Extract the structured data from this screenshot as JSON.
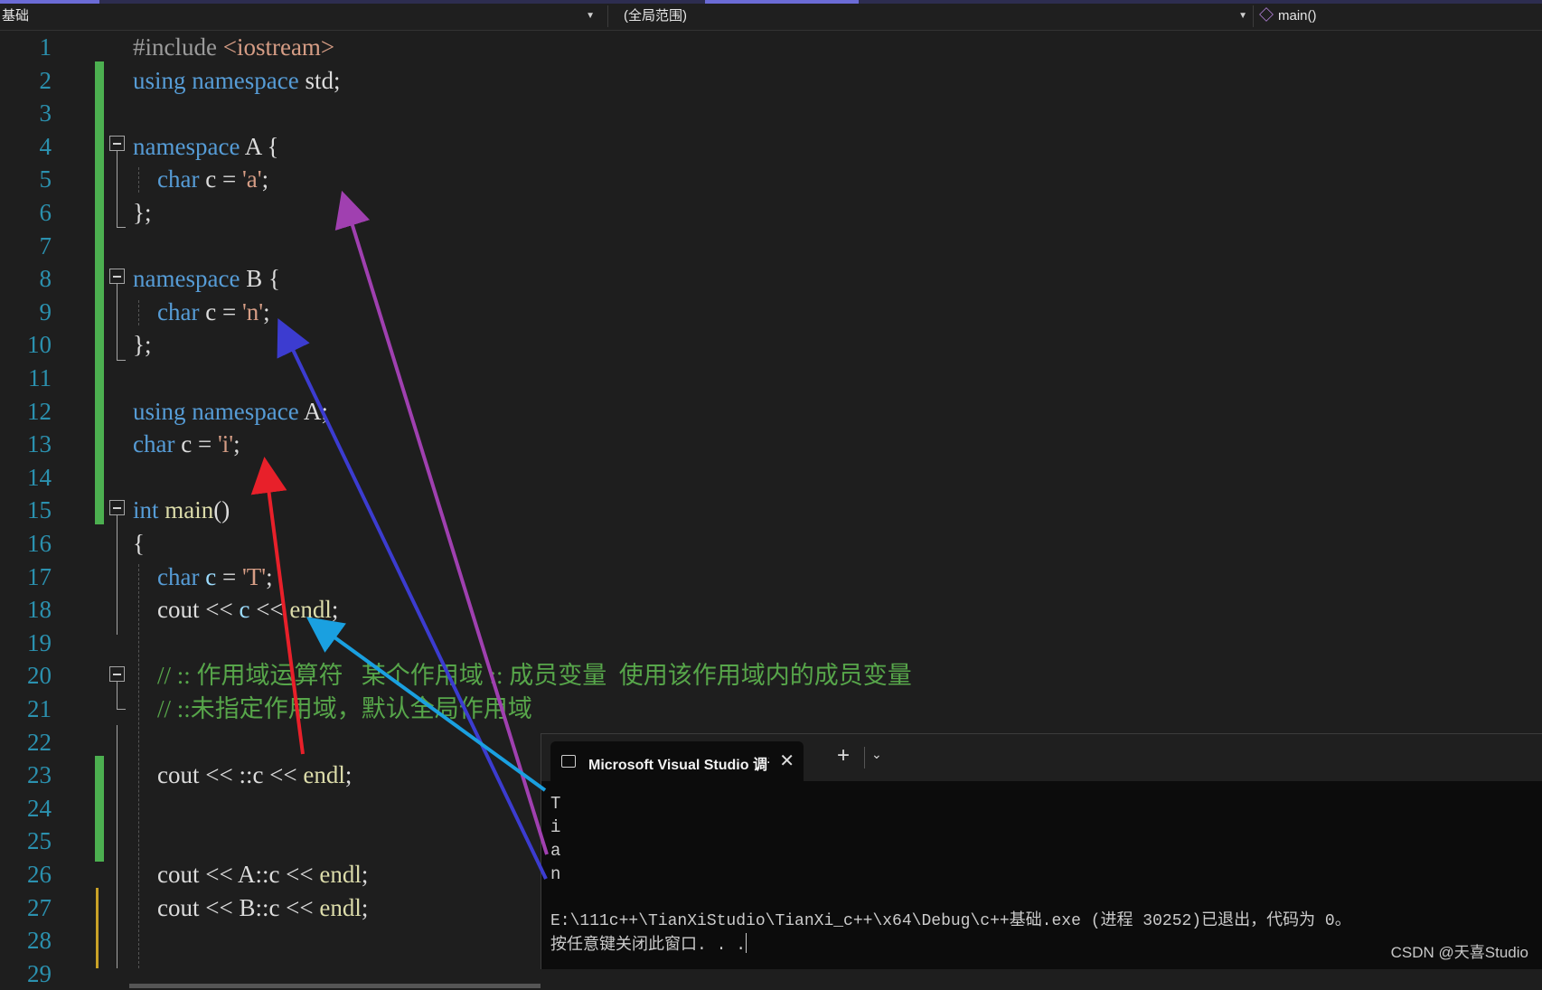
{
  "navbar": {
    "project": "基础",
    "scope": "(全局范围)",
    "member": "main()"
  },
  "editor": {
    "lines": [
      {
        "n": "1",
        "tokens": [
          {
            "t": "#include ",
            "c": "inc"
          },
          {
            "t": "<iostream>",
            "c": "str"
          }
        ]
      },
      {
        "n": "2",
        "tokens": [
          {
            "t": "using",
            "c": "kw"
          },
          {
            "t": " "
          },
          {
            "t": "namespace",
            "c": "kw"
          },
          {
            "t": " std;"
          }
        ]
      },
      {
        "n": "3",
        "tokens": []
      },
      {
        "n": "4",
        "tokens": [
          {
            "t": "namespace",
            "c": "kw"
          },
          {
            "t": " A {"
          }
        ]
      },
      {
        "n": "5",
        "tokens": [
          {
            "t": "    "
          },
          {
            "t": "char",
            "c": "kw"
          },
          {
            "t": " c = "
          },
          {
            "t": "'a'",
            "c": "str"
          },
          {
            "t": ";"
          }
        ]
      },
      {
        "n": "6",
        "tokens": [
          {
            "t": "};"
          }
        ]
      },
      {
        "n": "7",
        "tokens": []
      },
      {
        "n": "8",
        "tokens": [
          {
            "t": "namespace",
            "c": "kw"
          },
          {
            "t": " B {"
          }
        ]
      },
      {
        "n": "9",
        "tokens": [
          {
            "t": "    "
          },
          {
            "t": "char",
            "c": "kw"
          },
          {
            "t": " c = "
          },
          {
            "t": "'n'",
            "c": "str"
          },
          {
            "t": ";"
          }
        ]
      },
      {
        "n": "10",
        "tokens": [
          {
            "t": "};"
          }
        ]
      },
      {
        "n": "11",
        "tokens": []
      },
      {
        "n": "12",
        "tokens": [
          {
            "t": "using",
            "c": "kw"
          },
          {
            "t": " "
          },
          {
            "t": "namespace",
            "c": "kw"
          },
          {
            "t": " A;"
          }
        ]
      },
      {
        "n": "13",
        "tokens": [
          {
            "t": "char",
            "c": "kw"
          },
          {
            "t": " c = "
          },
          {
            "t": "'i'",
            "c": "str"
          },
          {
            "t": ";"
          }
        ]
      },
      {
        "n": "14",
        "tokens": []
      },
      {
        "n": "15",
        "tokens": [
          {
            "t": "int",
            "c": "kw"
          },
          {
            "t": " "
          },
          {
            "t": "main",
            "c": "fn"
          },
          {
            "t": "()"
          }
        ]
      },
      {
        "n": "16",
        "tokens": [
          {
            "t": "{"
          }
        ]
      },
      {
        "n": "17",
        "tokens": [
          {
            "t": "    "
          },
          {
            "t": "char",
            "c": "kw"
          },
          {
            "t": " "
          },
          {
            "t": "c",
            "c": "var"
          },
          {
            "t": " = "
          },
          {
            "t": "'T'",
            "c": "str"
          },
          {
            "t": ";"
          }
        ]
      },
      {
        "n": "18",
        "tokens": [
          {
            "t": "    cout << "
          },
          {
            "t": "c",
            "c": "var"
          },
          {
            "t": " << "
          },
          {
            "t": "endl",
            "c": "fn"
          },
          {
            "t": ";"
          }
        ]
      },
      {
        "n": "19",
        "tokens": []
      },
      {
        "n": "20",
        "tokens": [
          {
            "t": "    // :: 作用域运算符   某个作用域 :: 成员变量  使用该作用域内的成员变量",
            "c": "cm"
          }
        ]
      },
      {
        "n": "21",
        "tokens": [
          {
            "t": "    // ::未指定作用域，默认全局作用域",
            "c": "cm"
          }
        ]
      },
      {
        "n": "22",
        "tokens": []
      },
      {
        "n": "23",
        "tokens": [
          {
            "t": "    cout << ::c << "
          },
          {
            "t": "endl",
            "c": "fn"
          },
          {
            "t": ";"
          }
        ]
      },
      {
        "n": "24",
        "tokens": []
      },
      {
        "n": "25",
        "tokens": []
      },
      {
        "n": "26",
        "tokens": [
          {
            "t": "    cout << A::c << "
          },
          {
            "t": "endl",
            "c": "fn"
          },
          {
            "t": ";"
          }
        ]
      },
      {
        "n": "27",
        "tokens": [
          {
            "t": "    cout << B::c << "
          },
          {
            "t": "endl",
            "c": "fn"
          },
          {
            "t": ";"
          }
        ]
      },
      {
        "n": "28",
        "tokens": []
      },
      {
        "n": "29",
        "tokens": []
      }
    ]
  },
  "terminal": {
    "tab_title": "Microsoft Visual Studio 调试",
    "output_lines": [
      "T",
      "i",
      "a",
      "n"
    ],
    "exit_message": "E:\\111c++\\TianXiStudio\\TianXi_c++\\x64\\Debug\\c++基础.exe (进程 30252)已退出，代码为 0。",
    "prompt": "按任意键关闭此窗口. . ."
  },
  "watermark": "CSDN @天喜Studio",
  "annotation_colors": {
    "magenta": "#a040b0",
    "blue": "#3c3cd0",
    "red": "#e8202a",
    "cyan": "#1aa0e0"
  }
}
